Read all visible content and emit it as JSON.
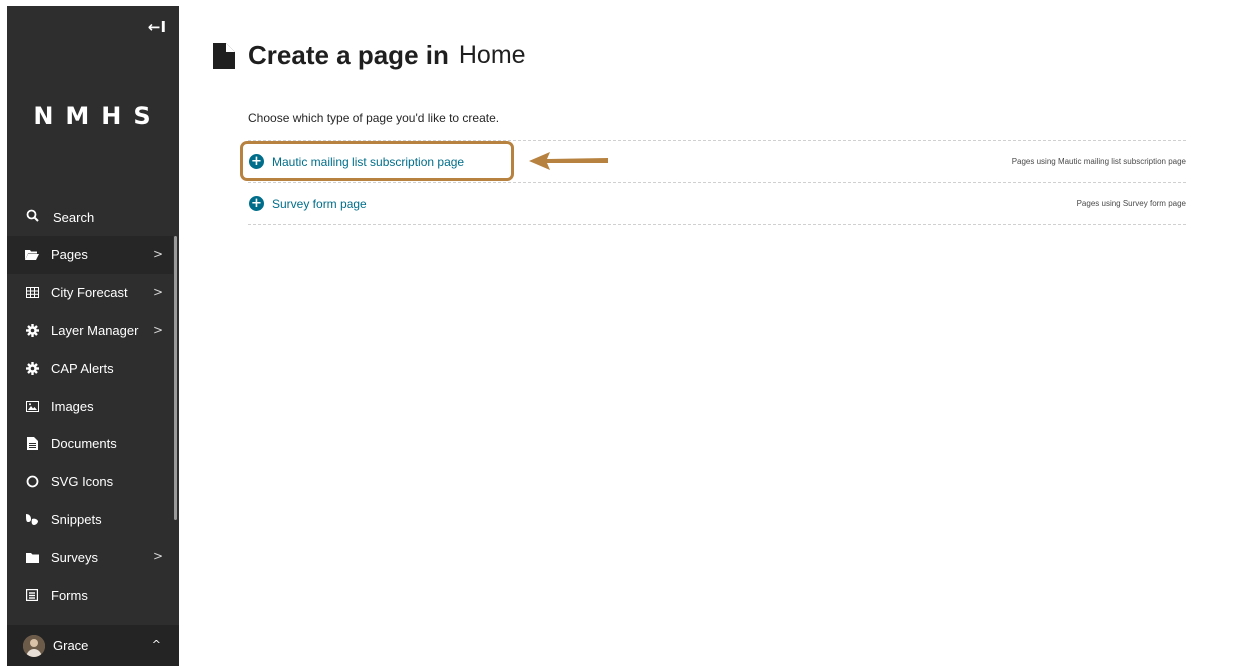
{
  "sidebar": {
    "collapse_label": "←I",
    "logo": "NMHS",
    "search_label": "Search",
    "items": [
      {
        "label": "Pages",
        "icon": "folder-open-icon",
        "has_children": true
      },
      {
        "label": "City Forecast",
        "icon": "table-icon",
        "has_children": true
      },
      {
        "label": "Layer Manager",
        "icon": "cog-icon",
        "has_children": true
      },
      {
        "label": "CAP Alerts",
        "icon": "cog-icon",
        "has_children": false
      },
      {
        "label": "Images",
        "icon": "image-icon",
        "has_children": false
      },
      {
        "label": "Documents",
        "icon": "doc-full-icon",
        "has_children": false
      },
      {
        "label": "SVG Icons",
        "icon": "circle-icon",
        "has_children": false
      },
      {
        "label": "Snippets",
        "icon": "snippet-icon",
        "has_children": false
      },
      {
        "label": "Surveys",
        "icon": "folder-icon",
        "has_children": true
      },
      {
        "label": "Forms",
        "icon": "form-icon",
        "has_children": false
      }
    ],
    "account_name": "Grace"
  },
  "header": {
    "title_strong": "Create a page in",
    "title_light": "Home"
  },
  "main": {
    "intro": "Choose which type of page you'd like to create.",
    "page_types": [
      {
        "label": "Mautic mailing list subscription page",
        "count_label": "Pages using Mautic mailing list subscription page"
      },
      {
        "label": "Survey form page",
        "count_label": "Pages using Survey form page"
      }
    ]
  },
  "colors": {
    "sidebar_bg": "#2e2e2e",
    "link": "#006e8a",
    "annotation": "#b7823f"
  }
}
